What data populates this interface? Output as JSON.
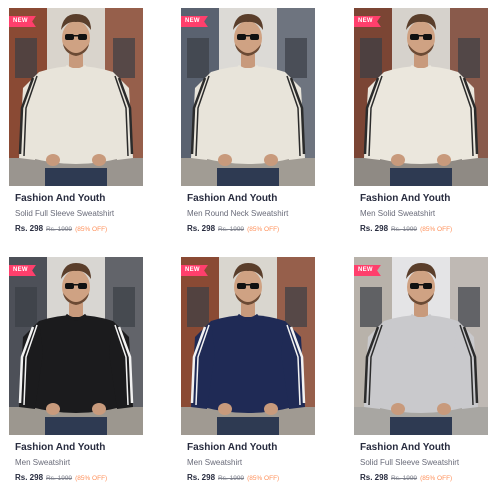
{
  "products": [
    {
      "badge": "NEW",
      "brand": "Fashion And Youth",
      "name": "Solid Full Sleeve Sweatshirt",
      "price": "Rs. 298",
      "mrp": "Rs. 1999",
      "discount": "(85% OFF)",
      "sweater_color": "#e8e4da",
      "stripe_color": "#2b2b2b"
    },
    {
      "badge": "NEW",
      "brand": "Fashion And Youth",
      "name": "Men Round Neck Sweatshirt",
      "price": "Rs. 298",
      "mrp": "Rs. 1999",
      "discount": "(85% OFF)",
      "sweater_color": "#e8e4da",
      "stripe_color": "#2b2b2b"
    },
    {
      "badge": "NEW",
      "brand": "Fashion And Youth",
      "name": "Men Solid Sweatshirt",
      "price": "Rs. 298",
      "mrp": "Rs. 1999",
      "discount": "(85% OFF)",
      "sweater_color": "#ebe7dd",
      "stripe_color": "#2b2b2b"
    },
    {
      "badge": "NEW",
      "brand": "Fashion And Youth",
      "name": "Men Sweatshirt",
      "price": "Rs. 298",
      "mrp": "Rs. 1999",
      "discount": "(85% OFF)",
      "sweater_color": "#1b1b1d",
      "stripe_color": "#f2f2f2"
    },
    {
      "badge": "NEW",
      "brand": "Fashion And Youth",
      "name": "Men Sweatshirt",
      "price": "Rs. 298",
      "mrp": "Rs. 1999",
      "discount": "(85% OFF)",
      "sweater_color": "#1f2a55",
      "stripe_color": "#f2f2f2"
    },
    {
      "badge": "NEW",
      "brand": "Fashion And Youth",
      "name": "Solid Full Sleeve Sweatshirt",
      "price": "Rs. 298",
      "mrp": "Rs. 1999",
      "discount": "(85% OFF)",
      "sweater_color": "#c9c9cc",
      "stripe_color": "#2b2b2b"
    }
  ]
}
